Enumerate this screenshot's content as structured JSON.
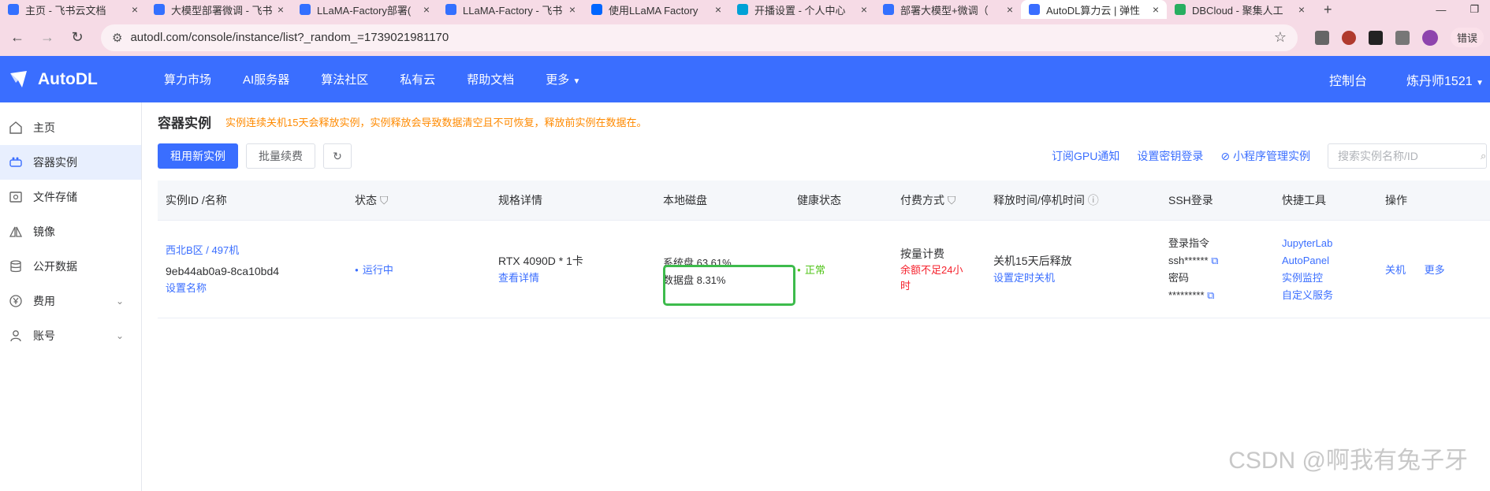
{
  "browser": {
    "tabs": [
      {
        "title": "主页 - 飞书云文档",
        "color": "#3370ff",
        "active": false
      },
      {
        "title": "大模型部署微调 - 飞书",
        "color": "#3370ff",
        "active": false
      },
      {
        "title": "LLaMA-Factory部署(",
        "color": "#3370ff",
        "active": false
      },
      {
        "title": "LLaMA-Factory - 飞书",
        "color": "#3370ff",
        "active": false
      },
      {
        "title": "使用LLaMA Factory",
        "color": "#0066ff",
        "active": false
      },
      {
        "title": "开播设置 - 个人中心",
        "color": "#00a1d6",
        "active": false
      },
      {
        "title": "部署大模型+微调（",
        "color": "#3370ff",
        "active": false
      },
      {
        "title": "AutoDL算力云 | 弹性",
        "color": "#3a6eff",
        "active": true
      },
      {
        "title": "DBCloud - 聚集人工",
        "color": "#27ae60",
        "active": false
      }
    ],
    "url": "autodl.com/console/instance/list?_random_=1739021981170",
    "error_label": "错误"
  },
  "header": {
    "brand": "AutoDL",
    "nav": [
      "算力市场",
      "AI服务器",
      "算法社区",
      "私有云",
      "帮助文档",
      "更多"
    ],
    "console": "控制台",
    "user": "炼丹师1521"
  },
  "sidebar": {
    "items": [
      {
        "label": "主页",
        "icon": "home-icon",
        "active": false,
        "expandable": false
      },
      {
        "label": "容器实例",
        "icon": "container-icon",
        "active": true,
        "expandable": false
      },
      {
        "label": "文件存储",
        "icon": "storage-icon",
        "active": false,
        "expandable": false
      },
      {
        "label": "镜像",
        "icon": "image-icon",
        "active": false,
        "expandable": false
      },
      {
        "label": "公开数据",
        "icon": "database-icon",
        "active": false,
        "expandable": false
      },
      {
        "label": "费用",
        "icon": "yen-icon",
        "active": false,
        "expandable": true
      },
      {
        "label": "账号",
        "icon": "user-icon",
        "active": false,
        "expandable": true
      }
    ]
  },
  "page": {
    "title": "容器实例",
    "warning": "实例连续关机15天会释放实例，实例释放会导致数据清空且不可恢复，释放前实例在数据在。",
    "buttons": {
      "new": "租用新实例",
      "renew": "批量续费"
    },
    "links": {
      "gpu_notify": "订阅GPU通知",
      "keys": "设置密钥登录",
      "miniapp": "小程序管理实例"
    },
    "search_placeholder": "搜索实例名称/ID"
  },
  "table": {
    "headers": [
      "实例ID /名称",
      "状态",
      "规格详情",
      "本地磁盘",
      "健康状态",
      "付费方式",
      "释放时间/停机时间",
      "SSH登录",
      "快捷工具",
      "操作"
    ],
    "row": {
      "region": "西北B区 / 497机",
      "id": "9eb44ab0a9-8ca10bd4",
      "set_name": "设置名称",
      "status": "运行中",
      "spec": "RTX 4090D * 1卡",
      "spec_detail": "查看详情",
      "disk_system": "系统盘 63.61%",
      "disk_data": "数据盘 8.31%",
      "health": "正常",
      "billing": "按量计费",
      "billing_warn_1": "余额不足24小",
      "billing_warn_2": "时",
      "release": "关机15天后释放",
      "release_link": "设置定时关机",
      "ssh_cmd_label": "登录指令",
      "ssh_cmd": "ssh******",
      "pwd_label": "密码",
      "pwd": "*********",
      "tools": [
        "JupyterLab",
        "AutoPanel",
        "实例监控",
        "自定义服务"
      ],
      "ops": [
        "关机",
        "更多"
      ]
    }
  },
  "watermark": "CSDN @啊我有兔子牙",
  "colors": {
    "primary": "#3a6eff",
    "warning": "#ff8a00",
    "danger": "#f5222d",
    "success": "#52c41a",
    "highlight_box": "#3dbb4c"
  }
}
